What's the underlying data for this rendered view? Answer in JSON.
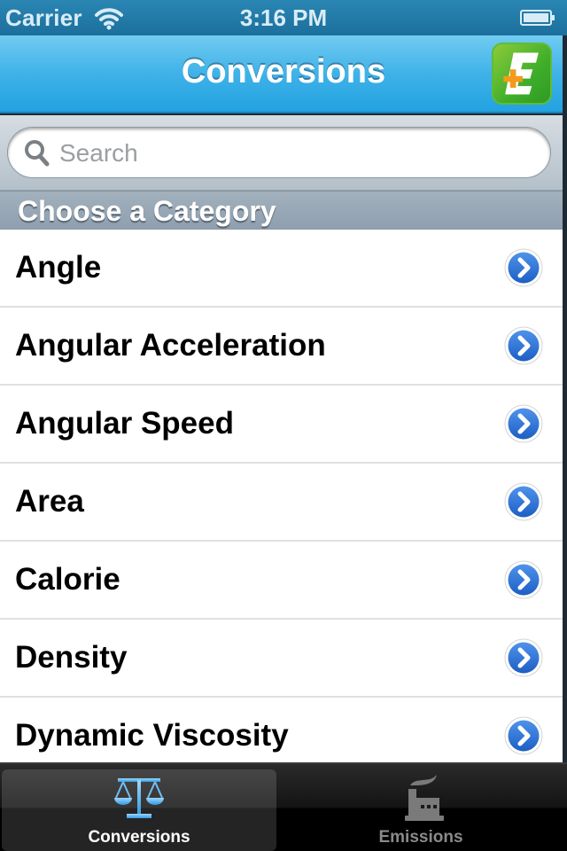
{
  "status_bar": {
    "carrier": "Carrier",
    "time": "3:16 PM",
    "wifi_icon": "wifi-icon",
    "battery_icon": "battery-icon"
  },
  "nav_bar": {
    "title": "Conversions",
    "logo_icon": "app-logo-e-plus-icon"
  },
  "search": {
    "placeholder": "Search",
    "value": ""
  },
  "section": {
    "header": "Choose a Category"
  },
  "categories": [
    {
      "label": "Angle"
    },
    {
      "label": "Angular Acceleration"
    },
    {
      "label": "Angular Speed"
    },
    {
      "label": "Area"
    },
    {
      "label": "Calorie"
    },
    {
      "label": "Density"
    },
    {
      "label": "Dynamic Viscosity"
    }
  ],
  "tab_bar": {
    "tabs": [
      {
        "label": "Conversions",
        "icon": "scales-icon",
        "active": true
      },
      {
        "label": "Emissions",
        "icon": "factory-icon",
        "active": false
      }
    ]
  },
  "colors": {
    "nav_accent": "#3fb2e8",
    "disclosure_blue": "#2a73d8",
    "logo_green": "#3fae2a",
    "logo_orange": "#f39a1c",
    "active_tab_icon": "#4fb0ee"
  }
}
